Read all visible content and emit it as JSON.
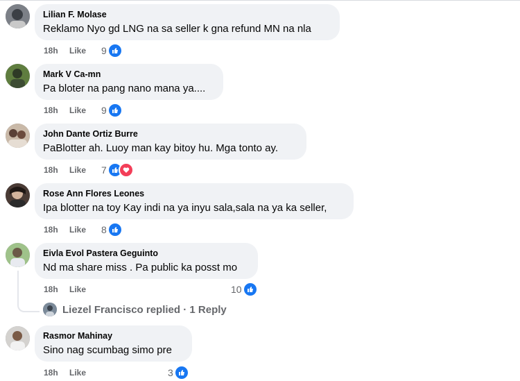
{
  "comments": [
    {
      "author": "Lilian F. Molase",
      "text": "Reklamo Nyo gd LNG na sa seller k gna refund MN na nla",
      "time": "18h",
      "like_label": "Like",
      "reaction_count": "9",
      "reactions": [
        "like"
      ]
    },
    {
      "author": "Mark V Ca-mn",
      "text": "Pa bloter na pang nano mana ya....",
      "time": "18h",
      "like_label": "Like",
      "reaction_count": "9",
      "reactions": [
        "like"
      ]
    },
    {
      "author": "John Dante Ortiz Burre",
      "text": "PaBlotter ah. Luoy man kay bitoy hu. Mga tonto ay.",
      "time": "18h",
      "like_label": "Like",
      "reaction_count": "7",
      "reactions": [
        "like",
        "love"
      ]
    },
    {
      "author": "Rose Ann Flores Leones",
      "text": "Ipa blotter na toy Kay indi na ya inyu sala,sala na ya ka seller,",
      "time": "18h",
      "like_label": "Like",
      "reaction_count": "8",
      "reactions": [
        "like"
      ]
    },
    {
      "author": "Eivla Evol Pastera Geguinto",
      "text": "Nd ma share miss . Pa public ka posst mo",
      "time": "18h",
      "like_label": "Like",
      "reaction_count": "10",
      "reactions": [
        "like"
      ]
    },
    {
      "author": "Rasmor Mahinay",
      "text": "Sino nag scumbag simo pre",
      "time": "18h",
      "like_label": "Like",
      "reaction_count": "3",
      "reactions": [
        "like"
      ]
    }
  ],
  "reply_summary": "Liezel Francisco replied · 1 Reply",
  "colors": {
    "bubble": "#f0f2f5",
    "meta": "#65676b",
    "like_blue": "#1877f2",
    "love_red": "#f33e58"
  }
}
